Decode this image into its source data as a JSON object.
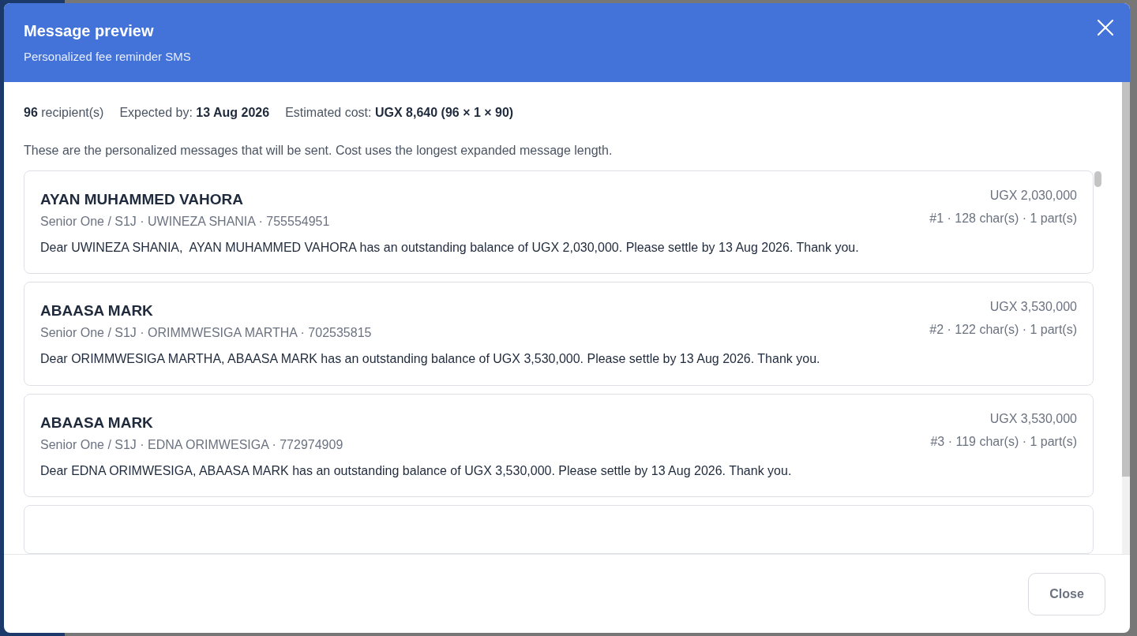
{
  "dialog": {
    "title": "Message preview",
    "subtitle": "Personalized fee reminder SMS"
  },
  "summary": [
    "**96** recipient(s)",
    "Expected by: **13 Aug 2026**",
    "Estimated cost: **UGX 8,640 (96 × 1 × 90)**"
  ],
  "description": "These are the personalized messages that will be sent. Cost uses the longest expanded message length.",
  "messages": [
    {
      "student": "AYAN MUHAMMED VAHORA",
      "details": "Senior One / S1J · UWINEZA SHANIA · 755554951",
      "balance": "UGX 2,030,000",
      "stats": "#1 · 128 char(s) · 1 part(s)",
      "text": "Dear UWINEZA SHANIA,  AYAN MUHAMMED VAHORA has an outstanding balance of UGX 2,030,000. Please settle by 13 Aug 2026. Thank you."
    },
    {
      "student": "ABAASA MARK",
      "details": "Senior One / S1J · ORIMMWESIGA MARTHA · 702535815",
      "balance": "UGX 3,530,000",
      "stats": "#2 · 122 char(s) · 1 part(s)",
      "text": "Dear ORIMMWESIGA MARTHA, ABAASA MARK has an outstanding balance of UGX 3,530,000. Please settle by 13 Aug 2026. Thank you."
    },
    {
      "student": "ABAASA MARK",
      "details": "Senior One / S1J · EDNA ORIMWESIGA · 772974909",
      "balance": "UGX 3,530,000",
      "stats": "#3 · 119 char(s) · 1 part(s)",
      "text": "Dear EDNA ORIMWESIGA, ABAASA MARK has an outstanding balance of UGX 3,530,000. Please settle by 13 Aug 2026. Thank you."
    }
  ],
  "footer": {
    "close_button": "Close"
  }
}
